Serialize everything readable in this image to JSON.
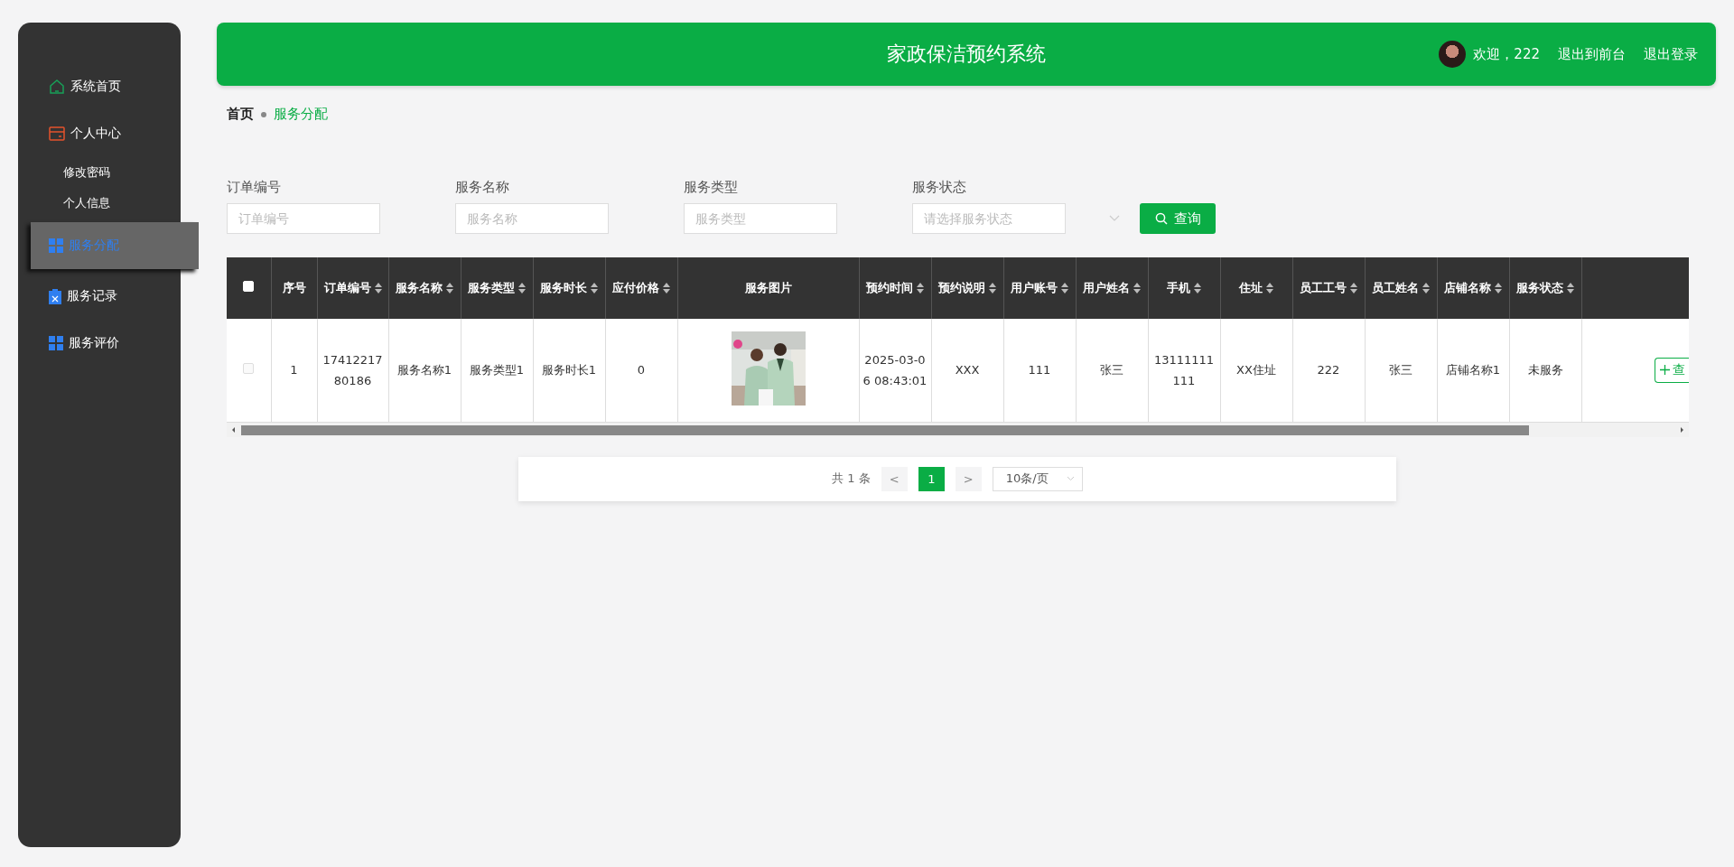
{
  "sidebar": {
    "items": [
      {
        "label": "系统首页",
        "selected": false
      },
      {
        "label": "个人中心",
        "selected": false,
        "children": [
          {
            "label": "修改密码",
            "selected": false
          },
          {
            "label": "个人信息",
            "selected": false
          }
        ]
      },
      {
        "label": "服务分配",
        "selected": true
      },
      {
        "label": "服务记录",
        "selected": false
      },
      {
        "label": "服务评价",
        "selected": false
      }
    ]
  },
  "header": {
    "title": "家政保洁预约系统",
    "welcome": "欢迎，222",
    "links": [
      "退出到前台",
      "退出登录"
    ]
  },
  "breadcrumb": [
    {
      "label": "首页",
      "current": false
    },
    {
      "label": "服务分配",
      "current": true
    }
  ],
  "search": {
    "fields": [
      {
        "kind": "input",
        "label": "订单编号",
        "placeholder": "订单编号"
      },
      {
        "kind": "input",
        "label": "服务名称",
        "placeholder": "服务名称"
      },
      {
        "kind": "input",
        "label": "服务类型",
        "placeholder": "服务类型"
      },
      {
        "kind": "select",
        "label": "服务状态",
        "placeholder": "请选择服务状态"
      }
    ],
    "button": "查询"
  },
  "table": {
    "select_all_checked": false,
    "columns": [
      {
        "label": "序号",
        "sortable": false
      },
      {
        "label": "订单编号",
        "sortable": true
      },
      {
        "label": "服务名称",
        "sortable": true
      },
      {
        "label": "服务类型",
        "sortable": true
      },
      {
        "label": "服务时长",
        "sortable": true
      },
      {
        "label": "应付价格",
        "sortable": true
      },
      {
        "label": "服务图片",
        "sortable": false
      },
      {
        "label": "预约时间",
        "sortable": true
      },
      {
        "label": "预约说明",
        "sortable": true
      },
      {
        "label": "用户账号",
        "sortable": true
      },
      {
        "label": "用户姓名",
        "sortable": true
      },
      {
        "label": "手机",
        "sortable": true
      },
      {
        "label": "住址",
        "sortable": true
      },
      {
        "label": "员工工号",
        "sortable": true
      },
      {
        "label": "员工姓名",
        "sortable": true
      },
      {
        "label": "店铺名称",
        "sortable": true
      },
      {
        "label": "服务状态",
        "sortable": true
      }
    ],
    "rows": [
      {
        "checked": false,
        "action": "查",
        "cells": [
          {
            "kind": "text",
            "text": "1"
          },
          {
            "kind": "text",
            "text": "1741221780186"
          },
          {
            "kind": "text",
            "text": "服务名称1"
          },
          {
            "kind": "text",
            "text": "服务类型1"
          },
          {
            "kind": "text",
            "text": "服务时长1"
          },
          {
            "kind": "text",
            "text": "0"
          },
          {
            "kind": "picture"
          },
          {
            "kind": "text",
            "text": "2025-03-06 08:43:01"
          },
          {
            "kind": "text",
            "text": "XXX"
          },
          {
            "kind": "text",
            "text": "111"
          },
          {
            "kind": "text",
            "text": "张三"
          },
          {
            "kind": "text",
            "text": "13111111111"
          },
          {
            "kind": "text",
            "text": "XX住址"
          },
          {
            "kind": "text",
            "text": "222"
          },
          {
            "kind": "text",
            "text": "张三"
          },
          {
            "kind": "text",
            "text": "店铺名称1"
          },
          {
            "kind": "text",
            "text": "未服务"
          }
        ]
      }
    ]
  },
  "pagination": {
    "total": "共 1 条",
    "prev": "<",
    "pages": [
      {
        "label": "1",
        "selected": true
      }
    ],
    "next": ">",
    "page_size": "10条/页"
  }
}
